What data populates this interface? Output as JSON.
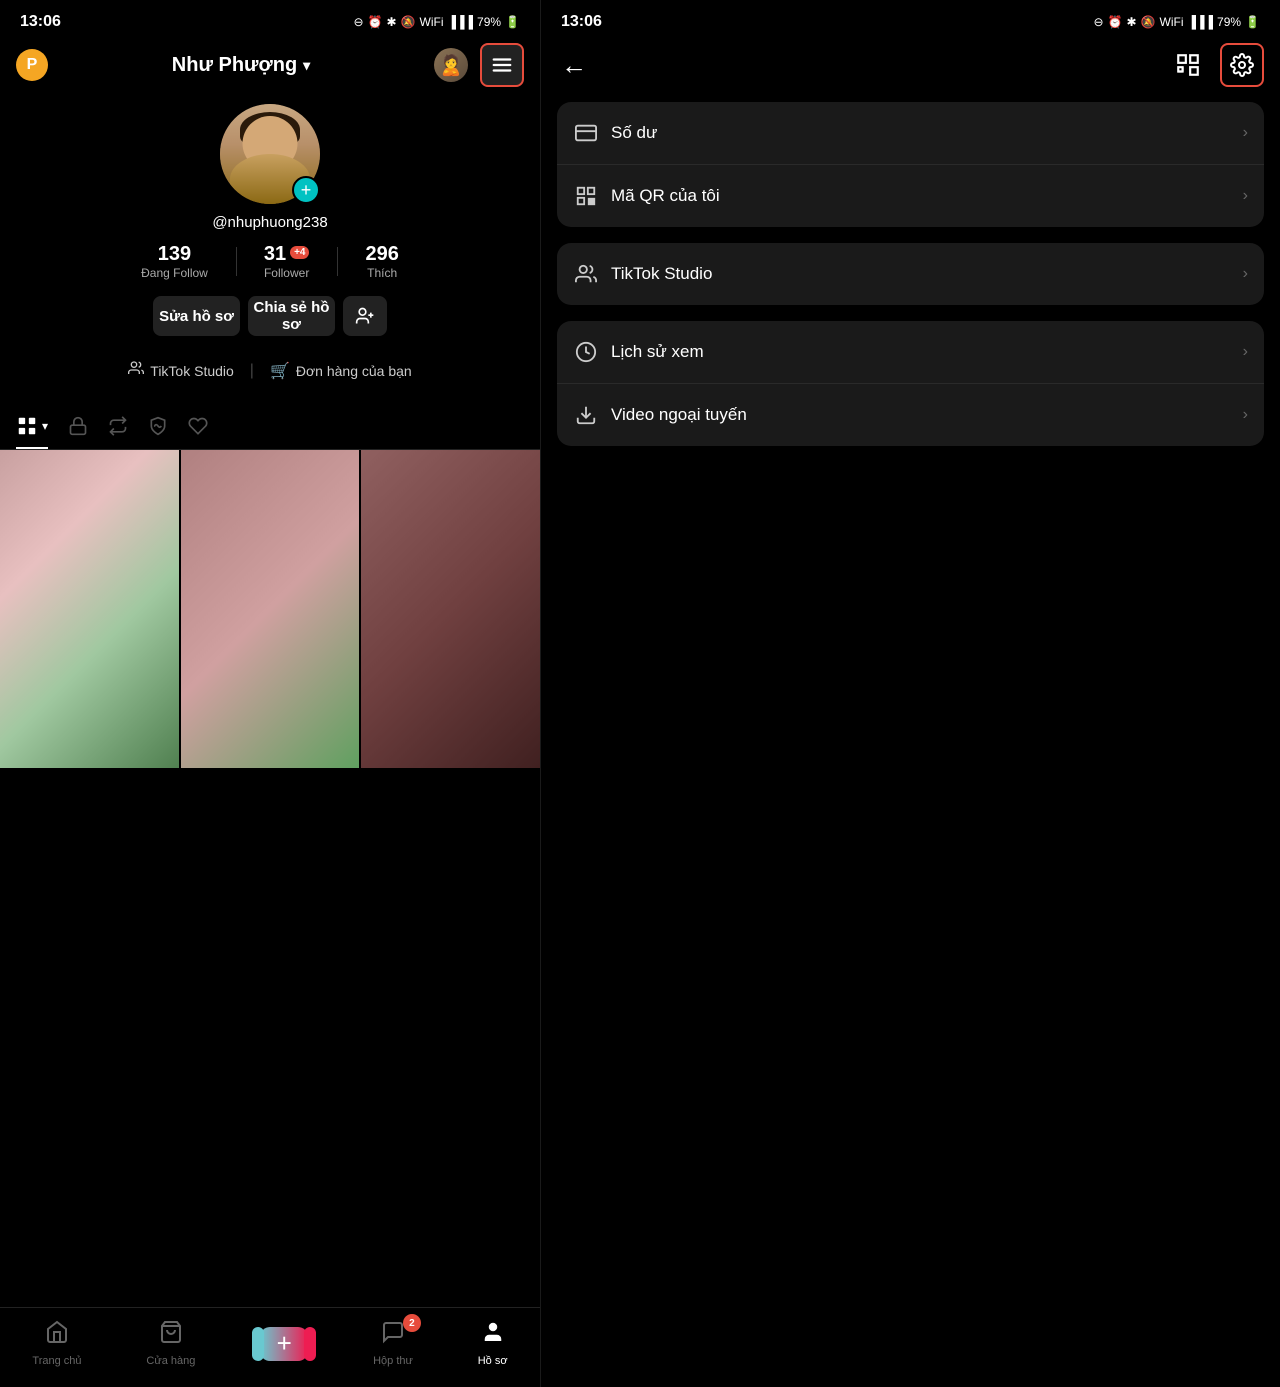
{
  "left": {
    "status": {
      "time": "13:06",
      "battery": "79%"
    },
    "nav": {
      "logo_letter": "P",
      "username_display": "Như Phượng",
      "chevron": "⌄"
    },
    "profile": {
      "username": "@nhuphuong238",
      "stats": [
        {
          "id": "following",
          "number": "139",
          "label": "Đang Follow",
          "badge": null
        },
        {
          "id": "followers",
          "number": "31",
          "label": "Follower",
          "badge": "+4"
        },
        {
          "id": "likes",
          "number": "296",
          "label": "Thích",
          "badge": null
        }
      ],
      "buttons": {
        "edit": "Sửa hồ sơ",
        "share": "Chia sẻ hồ sơ",
        "add_friend_icon": "person_add"
      },
      "shortcuts": [
        {
          "id": "tiktok-studio",
          "icon": "🎬",
          "label": "TikTok Studio"
        },
        {
          "id": "orders",
          "icon": "🛒",
          "label": "Đơn hàng của bạn"
        }
      ]
    },
    "tabs": [
      {
        "id": "videos",
        "icon": "▦",
        "active": true
      },
      {
        "id": "private",
        "icon": "🔒",
        "active": false
      },
      {
        "id": "repost",
        "icon": "🔁",
        "active": false
      },
      {
        "id": "tagged",
        "icon": "🏷",
        "active": false
      },
      {
        "id": "liked",
        "icon": "❤",
        "active": false
      }
    ],
    "bottom_nav": [
      {
        "id": "home",
        "icon": "🏠",
        "label": "Trang chủ",
        "active": false
      },
      {
        "id": "shop",
        "icon": "🛍",
        "label": "Cửa hàng",
        "active": false
      },
      {
        "id": "create",
        "icon": "+",
        "label": "",
        "active": false
      },
      {
        "id": "inbox",
        "icon": "💬",
        "label": "Hộp thư",
        "active": false,
        "badge": "2"
      },
      {
        "id": "profile",
        "icon": "👤",
        "label": "Hồ sơ",
        "active": true
      }
    ]
  },
  "right": {
    "status": {
      "time": "13:06",
      "battery": "79%"
    },
    "menu_sections": [
      {
        "id": "section-1",
        "items": [
          {
            "id": "so-du",
            "icon": "wallet",
            "label": "Số dư"
          },
          {
            "id": "ma-qr",
            "icon": "qr",
            "label": "Mã QR của tôi"
          }
        ]
      },
      {
        "id": "section-2",
        "items": [
          {
            "id": "tiktok-studio",
            "icon": "studio",
            "label": "TikTok Studio"
          }
        ]
      },
      {
        "id": "section-3",
        "items": [
          {
            "id": "lich-su-xem",
            "icon": "history",
            "label": "Lịch sử xem"
          },
          {
            "id": "video-ngoai-tuyen",
            "icon": "download",
            "label": "Video ngoại tuyến"
          }
        ]
      }
    ]
  }
}
